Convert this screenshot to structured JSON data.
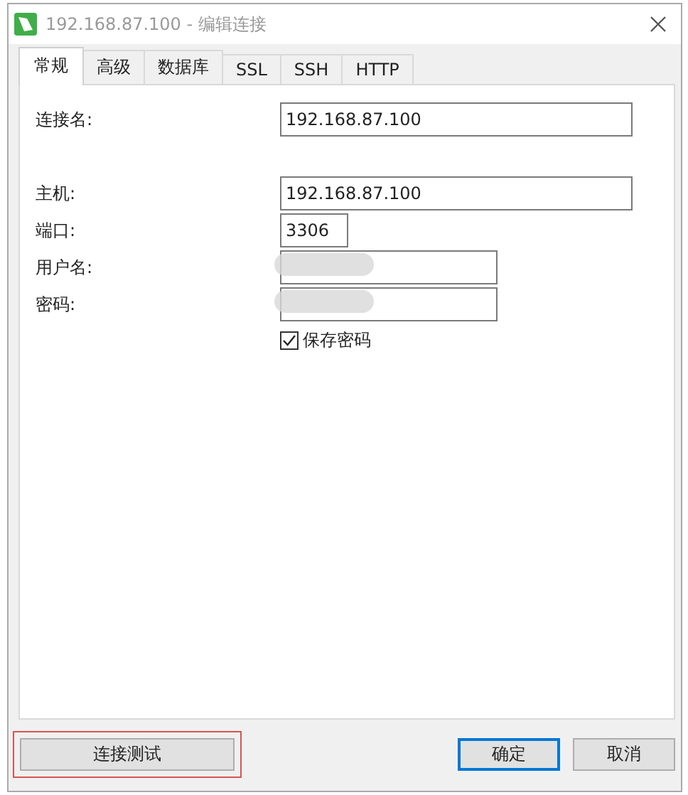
{
  "window": {
    "title": "192.168.87.100 - 编辑连接"
  },
  "tabs": [
    {
      "label": "常规",
      "selected": true
    },
    {
      "label": "高级",
      "selected": false
    },
    {
      "label": "数据库",
      "selected": false
    },
    {
      "label": "SSL",
      "selected": false
    },
    {
      "label": "SSH",
      "selected": false
    },
    {
      "label": "HTTP",
      "selected": false
    }
  ],
  "field_groups": [
    [
      {
        "label": "连接名:",
        "value": "192.168.87.100",
        "redacted": false
      }
    ],
    [
      {
        "label": "主机:",
        "value": "192.168.87.100",
        "redacted": false
      },
      {
        "label": "端口:",
        "value": "3306",
        "redacted": false
      },
      {
        "label": "用户名:",
        "redacted": true
      },
      {
        "label": "密码:",
        "redacted": true
      }
    ]
  ],
  "save_password": {
    "label": "保存密码",
    "checked": true
  },
  "test_button": {
    "label": "连接测试",
    "highlighted": true
  },
  "buttons": [
    {
      "label": "确定",
      "default": true
    },
    {
      "label": "取消",
      "default": false
    }
  ]
}
